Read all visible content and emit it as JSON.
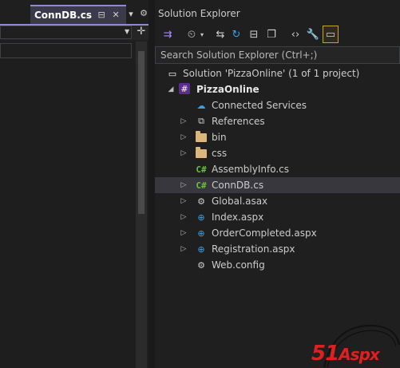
{
  "editor": {
    "tab_title": "ConnDB.cs",
    "tab_pin_icon": "pin-icon",
    "tab_close_icon": "close-icon",
    "tab_overflow_icon": "chevron-down-icon",
    "settings_icon": "gear-icon"
  },
  "solution_explorer": {
    "title": "Solution Explorer",
    "search_placeholder": "Search Solution Explorer (Ctrl+;)",
    "toolbar": [
      {
        "name": "switch-views-icon",
        "glyph": "⇉"
      },
      {
        "name": "history-icon",
        "glyph": "⏲"
      },
      {
        "name": "back-forward-icon",
        "glyph": "⇆"
      },
      {
        "name": "refresh-icon",
        "glyph": "↻"
      },
      {
        "name": "collapse-all-icon",
        "glyph": "⊟"
      },
      {
        "name": "copy-icon",
        "glyph": "❐"
      },
      {
        "name": "code-view-icon",
        "glyph": "‹›"
      },
      {
        "name": "properties-icon",
        "glyph": "🔧"
      },
      {
        "name": "preview-icon",
        "glyph": "▭"
      }
    ],
    "tree": [
      {
        "label": "Solution 'PizzaOnline' (1 of 1 project)",
        "icon": "solution-icon",
        "expander": "",
        "level": 0,
        "bold": false
      },
      {
        "label": "PizzaOnline",
        "icon": "csharp-project-icon",
        "expander": "◢",
        "level": 1,
        "bold": true
      },
      {
        "label": "Connected Services",
        "icon": "connected-services-icon",
        "expander": "",
        "level": 2,
        "bold": false
      },
      {
        "label": "References",
        "icon": "references-icon",
        "expander": "▷",
        "level": 2,
        "bold": false
      },
      {
        "label": "bin",
        "icon": "folder-icon",
        "expander": "▷",
        "level": 2,
        "bold": false
      },
      {
        "label": "css",
        "icon": "folder-icon",
        "expander": "▷",
        "level": 2,
        "bold": false
      },
      {
        "label": "AssemblyInfo.cs",
        "icon": "csharp-file-icon",
        "expander": "",
        "level": 2,
        "bold": false
      },
      {
        "label": "ConnDB.cs",
        "icon": "csharp-file-icon",
        "expander": "▷",
        "level": 2,
        "bold": false,
        "selected": true
      },
      {
        "label": "Global.asax",
        "icon": "asax-file-icon",
        "expander": "▷",
        "level": 2,
        "bold": false
      },
      {
        "label": "Index.aspx",
        "icon": "web-page-icon",
        "expander": "▷",
        "level": 2,
        "bold": false
      },
      {
        "label": "OrderCompleted.aspx",
        "icon": "web-page-icon",
        "expander": "▷",
        "level": 2,
        "bold": false
      },
      {
        "label": "Registration.aspx",
        "icon": "web-page-icon",
        "expander": "▷",
        "level": 2,
        "bold": false
      },
      {
        "label": "Web.config",
        "icon": "config-file-icon",
        "expander": "",
        "level": 2,
        "bold": false
      }
    ]
  },
  "watermark": {
    "text_number": "51",
    "text_word": "Aspx"
  },
  "colors": {
    "accent": "#8e8ad8",
    "selection": "#37373d",
    "background": "#1f1f1f"
  }
}
